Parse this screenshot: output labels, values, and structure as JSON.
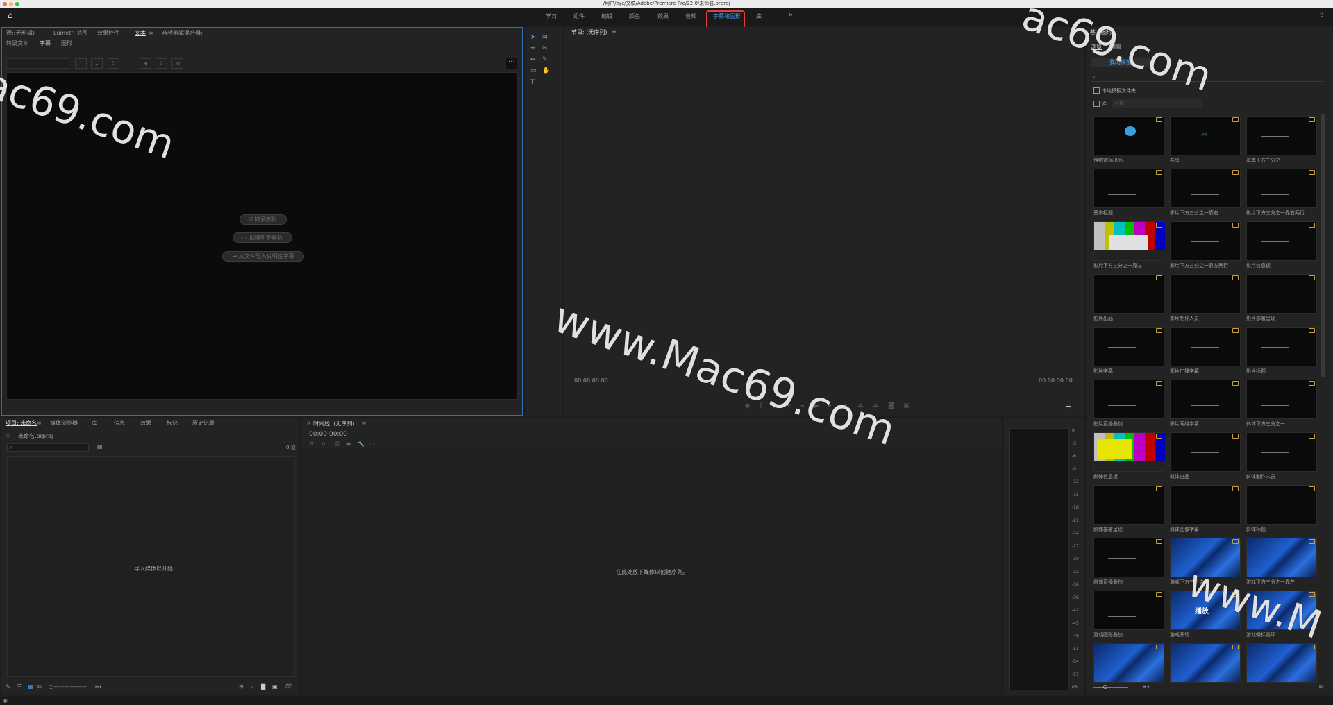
{
  "window": {
    "title": "/用户/zyc/文稿/Adobe/Premiere Pro/22.0/未命名.prproj"
  },
  "workspaces": [
    {
      "label": "学习"
    },
    {
      "label": "组件"
    },
    {
      "label": "编辑"
    },
    {
      "label": "颜色"
    },
    {
      "label": "效果"
    },
    {
      "label": "音频"
    },
    {
      "label": "字幕和图形",
      "active": true
    },
    {
      "label": "库"
    }
  ],
  "workspace_more": "»",
  "colors": {
    "accent": "#4aa3ff",
    "highlight_box": "#e04040",
    "panel_border": "#2d6fb8"
  },
  "source_panel": {
    "tabs": [
      "源:(无剪辑)",
      "Lumetri 范围",
      "效果控件",
      "文本",
      "音频剪辑混合器:"
    ],
    "active_tab": "文本",
    "sub_tabs": [
      "转录文本",
      "字幕",
      "图形"
    ],
    "active_sub_tab": "字幕",
    "buttons": [
      "转录序列",
      "创建新字幕轨",
      "从文件导入说明性字幕"
    ],
    "more": "···"
  },
  "program_monitor": {
    "title": "节目: (无序列)",
    "timecode_left": "00:00:00:00",
    "timecode_right": "00:00:00:00"
  },
  "project_panel": {
    "tabs": [
      "项目: 未命名",
      "媒体浏览器",
      "库",
      "信息",
      "效果",
      "标记",
      "历史记录"
    ],
    "file": "未命名.prproj",
    "count": "0 项",
    "empty_text": "导入媒体以开始"
  },
  "timeline": {
    "title": "时间线: (无序列)",
    "timecode": "00:00:00:00",
    "empty_text": "在此处放下媒体以创建序列。"
  },
  "audio_meter": {
    "ticks": [
      "0",
      "-3",
      "-6",
      "-9",
      "-12",
      "-15",
      "-18",
      "-21",
      "-24",
      "-27",
      "-30",
      "-33",
      "-36",
      "-39",
      "-42",
      "-45",
      "-48",
      "-51",
      "-54",
      "-57",
      "dB"
    ]
  },
  "essential_graphics": {
    "title": "基本图形",
    "tabs": [
      "浏览",
      "编辑"
    ],
    "active_tab": "浏览",
    "my_templates": "我的模板",
    "local_folder": "本地模板文件夹",
    "library_label": "库",
    "library_select": "全部",
    "templates": [
      "传统徽标出品",
      "共享",
      "基本下方三分之一",
      "基本标题",
      "影片下方三分之一靠右",
      "影片下方三分之一靠右两行",
      "影片下方三分之一靠左",
      "影片下方三分之一靠左两行",
      "影片信息板",
      "影片出品",
      "影片制作人员",
      "影片部署呈现",
      "影片字幕",
      "影片广播字幕",
      "影片标题",
      "影片直播叠加",
      "影片网络字幕",
      "斜体下方三分之一",
      "斜体信息板",
      "斜体出品",
      "斜体制作人员",
      "斜体部署呈现",
      "斜体图像字幕",
      "斜体标题",
      "斜体直播叠加",
      "游戏下方三分之一",
      "游戏下方三分之一靠左",
      "游戏图形叠加",
      "游戏开场",
      "游戏徽标循环",
      "",
      "",
      ""
    ],
    "thumb_texts": {
      "1": "共享",
      "28": "播放"
    }
  },
  "watermarks": [
    "ac69.com",
    "www.Mac69.com",
    "ac69.com",
    "www.M"
  ]
}
